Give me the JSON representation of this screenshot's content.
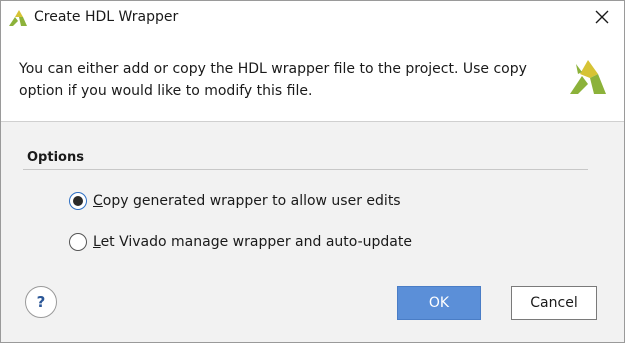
{
  "window": {
    "title": "Create HDL Wrapper",
    "icon": "vivado-logo-icon",
    "close_icon": "close-icon"
  },
  "header": {
    "message": "You can either add or copy the HDL wrapper file to the project. Use copy option if you would like to modify this file.",
    "logo": "vivado-logo-icon"
  },
  "options": {
    "heading": "Options",
    "choices": [
      {
        "mnemonic": "C",
        "rest": "opy generated wrapper to allow user edits",
        "selected": true
      },
      {
        "mnemonic": "L",
        "rest": "et Vivado manage wrapper and auto-update",
        "selected": false
      }
    ]
  },
  "footer": {
    "help_label": "?",
    "ok_label": "OK",
    "cancel_label": "Cancel"
  },
  "colors": {
    "accent": "#5b8fd8",
    "logo_green": "#8cb23a",
    "logo_yellow": "#d6c335"
  }
}
